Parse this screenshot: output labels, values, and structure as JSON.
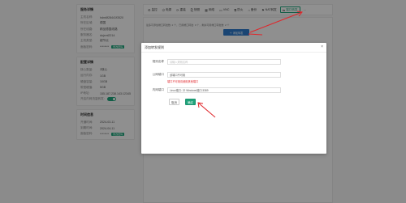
{
  "server_panel": {
    "title": "服务详情",
    "rows": [
      {
        "k": "主机名称:",
        "v": "hdm6f28441f3520"
      },
      {
        "k": "所在区域:",
        "v": "德国"
      },
      {
        "k": "所在线路:",
        "v": "精品德国线路"
      },
      {
        "k": "服务器名:",
        "v": "dujxml2214"
      },
      {
        "k": "主机类型:",
        "v": "超节点"
      }
    ],
    "password": {
      "k": "面板密码:",
      "v": "********",
      "badge": "修改密码"
    }
  },
  "config_panel": {
    "title": "配置详情",
    "rows": [
      {
        "k": "核心数量:",
        "v": "2核心"
      },
      {
        "k": "运行内存:",
        "v": "1GB"
      },
      {
        "k": "硬盘容量:",
        "v": "10GB"
      },
      {
        "k": "带宽峰值:",
        "v": "5GB"
      },
      {
        "k": "IP地址:",
        "v": "155.187.238.143:12345"
      }
    ],
    "toggle_label": "开启内网流量转发:"
  },
  "time_panel": {
    "title": "时间信息",
    "rows": [
      {
        "k": "开通时间:",
        "v": "2024-03-11"
      },
      {
        "k": "到期时间:",
        "v": "2024-04-11"
      }
    ],
    "password": {
      "k": "面板密码:",
      "v": "********",
      "badge": "修改密码"
    }
  },
  "tabs": [
    {
      "icon": "⚙",
      "label": "监控"
    },
    {
      "icon": "⏻",
      "label": "电源"
    },
    {
      "icon": "⟳",
      "label": "重装"
    },
    {
      "icon": "⎘",
      "label": "快照"
    },
    {
      "icon": "▦",
      "label": "网络"
    },
    {
      "icon": "▭",
      "label": "VNC"
    },
    {
      "icon": "⧉",
      "label": "防火"
    },
    {
      "icon": "⌂",
      "label": "备份"
    },
    {
      "icon": "⚑",
      "label": "NAT转发"
    },
    {
      "icon": "⇆",
      "label": "端口转发"
    }
  ],
  "tabs_more": "…",
  "notice": "最多可添加端口转发数: 2 个，已用端口转发: 0 个，剩余可用端口转发数: 2 个",
  "add_button": "添加转发",
  "modal": {
    "title": "添加转发规则",
    "close": "×",
    "name_label": "规则名称",
    "name_placeholder": "请输入规则名称",
    "public_label": "公网端口",
    "public_value": "该端口不可用",
    "public_error": "端口不可用请使用其他端口",
    "private_label": "内网端口",
    "private_value": "Linux端口: 22  Windows端口:3389",
    "cancel": "取消",
    "confirm": "确定"
  },
  "colors": {
    "accent": "#20a37a",
    "primary": "#2e78c7",
    "error": "#e0262b",
    "annotation": "#e0262b"
  }
}
